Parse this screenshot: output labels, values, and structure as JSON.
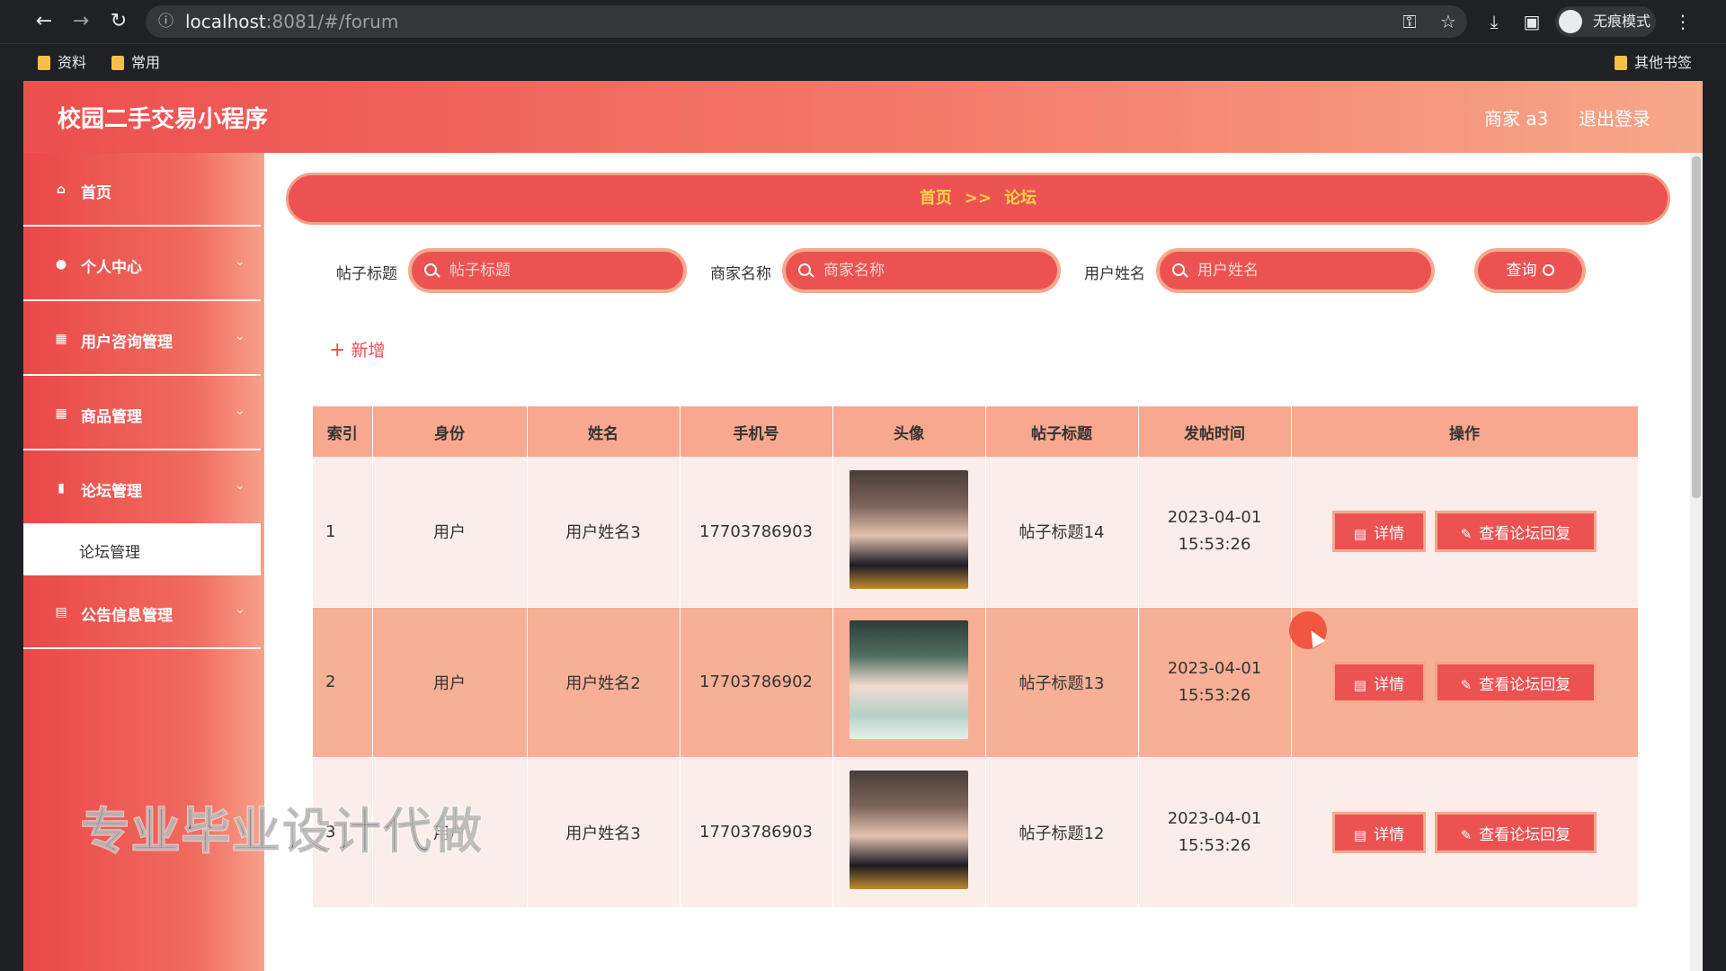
{
  "browser": {
    "url_host": "localhost",
    "url_path": ":8081/#/forum",
    "incognito_label": "无痕模式",
    "bookmarks": [
      "资料",
      "常用"
    ],
    "other_bookmarks": "其他书签"
  },
  "header": {
    "title": "校园二手交易小程序",
    "user_label": "商家 a3",
    "logout_label": "退出登录"
  },
  "sidebar": {
    "items": [
      {
        "label": "首页",
        "icon": "home-icon"
      },
      {
        "label": "个人中心",
        "icon": "user-icon"
      },
      {
        "label": "用户咨询管理",
        "icon": "grid-icon"
      },
      {
        "label": "商品管理",
        "icon": "grid-icon"
      },
      {
        "label": "论坛管理",
        "icon": "bar-chart-icon"
      },
      {
        "label": "公告信息管理",
        "icon": "clipboard-icon"
      }
    ],
    "active_subitem": "论坛管理"
  },
  "breadcrumb": {
    "home": "首页",
    "separator": ">>",
    "current": "论坛"
  },
  "search": {
    "title_label": "帖子标题",
    "title_placeholder": "帖子标题",
    "merchant_label": "商家名称",
    "merchant_placeholder": "商家名称",
    "user_label": "用户姓名",
    "user_placeholder": "用户姓名",
    "query_label": "查询"
  },
  "add_label": "新增",
  "table": {
    "headers": [
      "索引",
      "身份",
      "姓名",
      "手机号",
      "头像",
      "帖子标题",
      "发帖时间",
      "操作"
    ],
    "rows": [
      {
        "index": "1",
        "role": "用户",
        "name": "用户姓名3",
        "phone": "17703786903",
        "title": "帖子标题14",
        "time": "2023-04-01 15:53:26"
      },
      {
        "index": "2",
        "role": "用户",
        "name": "用户姓名2",
        "phone": "17703786902",
        "title": "帖子标题13",
        "time": "2023-04-01 15:53:26"
      },
      {
        "index": "3",
        "role": "用户",
        "name": "用户姓名3",
        "phone": "17703786903",
        "title": "帖子标题12",
        "time": "2023-04-01 15:53:26"
      }
    ],
    "detail_label": "详情",
    "reply_label": "查看论坛回复"
  },
  "watermark": "专业毕业设计代做",
  "colors": {
    "primary": "#ec5252",
    "accent_light": "#f7a88e",
    "breadcrumb_text": "#ffd447"
  }
}
